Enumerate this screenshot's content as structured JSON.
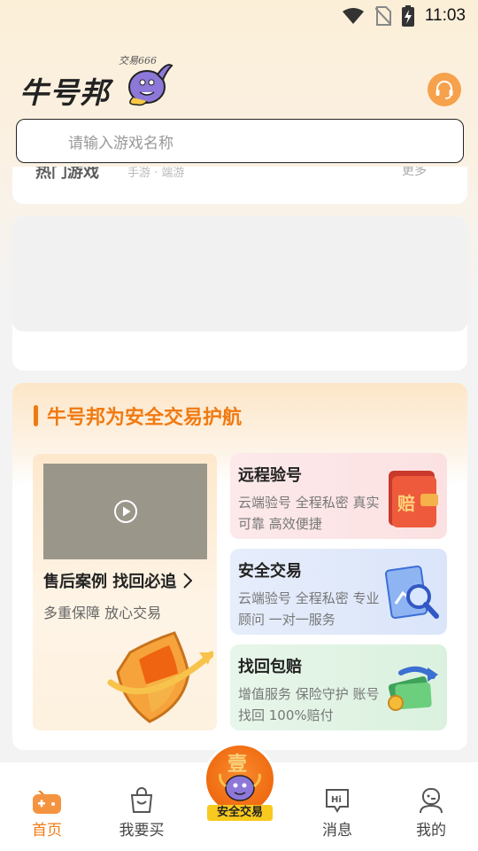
{
  "status_bar": {
    "time": "11:03"
  },
  "header": {
    "logo_text": "牛号邦",
    "mascot_tag": "交易666"
  },
  "search": {
    "placeholder": "请输入游戏名称"
  },
  "top_card": {
    "peek_title": "热门游戏",
    "peek_sub": "手游 · 端游",
    "peek_more": "更多"
  },
  "safe_section": {
    "title": "牛号邦为安全交易护航",
    "case": {
      "title": "售后案例 找回必追",
      "subtitle": "多重保障 放心交易"
    },
    "features": [
      {
        "title": "远程验号",
        "desc": "云端验号 全程私密 真实可靠 高效便捷",
        "icon": "compensation-wallet-icon"
      },
      {
        "title": "安全交易",
        "desc": "云端验号 全程私密 专业顾问 一对一服务",
        "icon": "magnifier-chart-icon"
      },
      {
        "title": "找回包赔",
        "desc": "增值服务 保险守护 账号找回 100%赔付",
        "icon": "money-return-icon"
      }
    ]
  },
  "tabbar": {
    "home": "首页",
    "buy": "我要买",
    "center": "安全交易",
    "messages": "消息",
    "mine": "我的"
  },
  "colors": {
    "accent": "#f07a12",
    "center_label_bg": "#f8c91e"
  }
}
